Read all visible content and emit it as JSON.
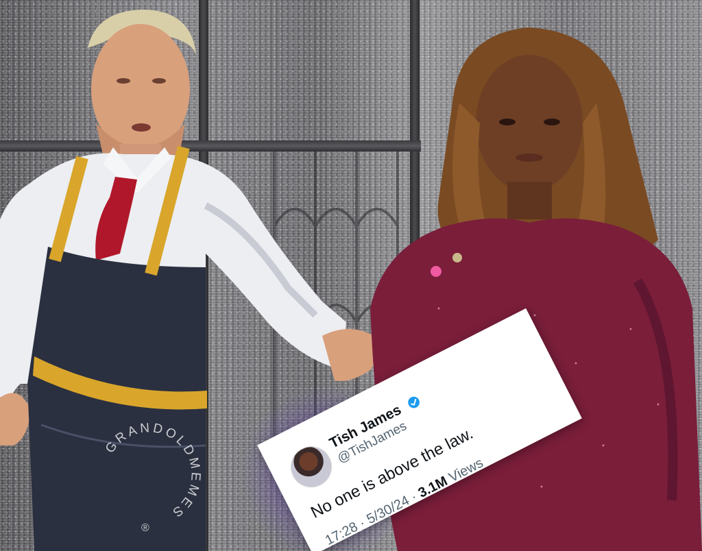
{
  "tweet": {
    "display_name": "Tish James",
    "handle": "@TishJames",
    "verified_icon": "verified-badge-icon",
    "text": "No one is above the law.",
    "time": "17:28",
    "date": "5/30/24",
    "separator": "·",
    "views_count": "3.1M",
    "views_label": "Views"
  },
  "watermark": {
    "text": "GRANDOLDMEMES",
    "registered": "®"
  },
  "colors": {
    "apron": "#2b3040",
    "apron_straps": "#d9a62b",
    "tie": "#b1172a",
    "sweater": "#7a1e3a",
    "shirt": "#eceef2",
    "verified_blue": "#1d9bf0"
  }
}
